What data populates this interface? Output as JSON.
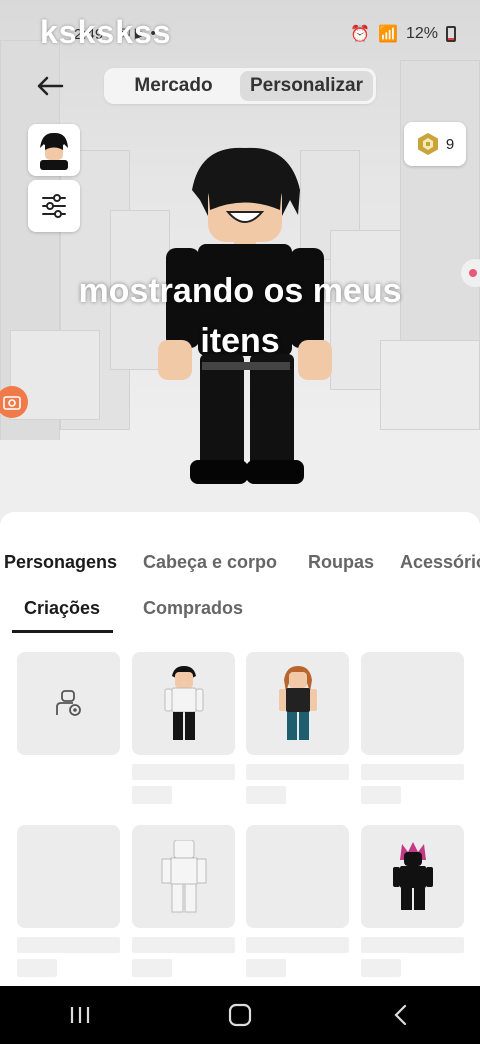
{
  "overlay": {
    "watermark": "kskskss",
    "caption_line1": "mostrando os meus",
    "caption_line2": "itens"
  },
  "status_bar": {
    "time": "2:49",
    "battery": "12%"
  },
  "top_nav": {
    "tab_market": "Mercado",
    "tab_customize": "Personalizar",
    "active": "Personalizar"
  },
  "robux": {
    "count": "9"
  },
  "categories": {
    "tabs": [
      "Personagens",
      "Cabeça e corpo",
      "Roupas",
      "Acessórios"
    ],
    "active": "Personagens"
  },
  "subtabs": {
    "items": [
      "Criações",
      "Comprados"
    ],
    "active": "Criações"
  },
  "grid": {
    "items": [
      {
        "type": "create",
        "icon": "create-character-icon"
      },
      {
        "type": "avatar",
        "icon": "avatar-white-shirt-icon"
      },
      {
        "type": "avatar",
        "icon": "avatar-brown-hair-icon"
      },
      {
        "type": "empty"
      },
      {
        "type": "empty"
      },
      {
        "type": "avatar",
        "icon": "avatar-blocky-white-icon"
      },
      {
        "type": "empty"
      },
      {
        "type": "avatar",
        "icon": "avatar-pink-hair-black-icon"
      }
    ]
  },
  "colors": {
    "accent_dark": "#1b1b1b",
    "card_bg": "#ececec",
    "camera_orange": "#f07a4a"
  }
}
